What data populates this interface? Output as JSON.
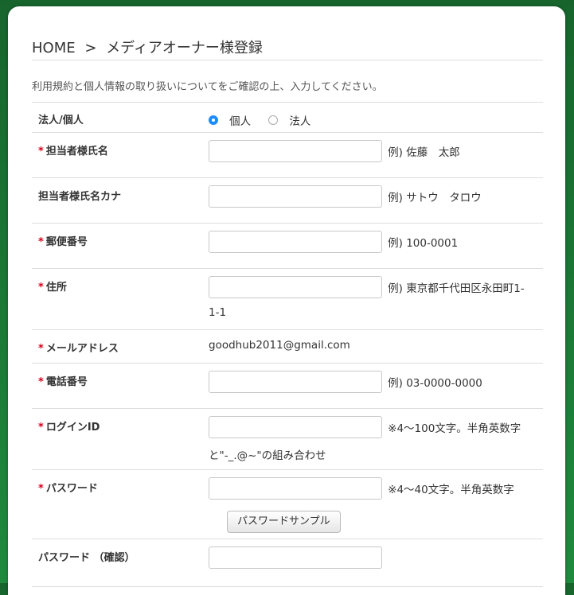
{
  "breadcrumb": {
    "home": "HOME",
    "sep": ">",
    "current": "メディアオーナー様登録"
  },
  "notice": "利用規約と個人情報の取り扱いについてをご確認の上、入力してください。",
  "required_mark": "*",
  "fields": {
    "entity_type": {
      "label": "法人/個人",
      "options": [
        "個人",
        "法人"
      ],
      "selected": "個人"
    },
    "name": {
      "label": "担当者様氏名",
      "value": "",
      "hint": "例) 佐藤　太郎"
    },
    "name_kana": {
      "label": "担当者様氏名カナ",
      "value": "",
      "hint": "例) サトウ　タロウ"
    },
    "postal": {
      "label": "郵便番号",
      "value": "",
      "hint": "例) 100-0001"
    },
    "address": {
      "label": "住所",
      "value": "",
      "hint": "例) 東京都千代田区永田町1-",
      "hint2": "1-1"
    },
    "email": {
      "label": "メールアドレス",
      "value": "goodhub2011@gmail.com"
    },
    "phone": {
      "label": "電話番号",
      "value": "",
      "hint": "例) 03-0000-0000"
    },
    "login_id": {
      "label": "ログインID",
      "value": "",
      "hint": "※4〜100文字。半角英数字",
      "hint2": "と\"-_.@~\"の組み合わせ"
    },
    "password": {
      "label": "パスワード",
      "value": "",
      "hint": "※4〜40文字。半角英数字",
      "button": "パスワードサンプル"
    },
    "password_confirm": {
      "label": "パスワード （確認）",
      "value": ""
    }
  },
  "colors": {
    "background": "#1f7a3a",
    "required": "#d0021b",
    "radio_accent": "#1a8cff"
  }
}
